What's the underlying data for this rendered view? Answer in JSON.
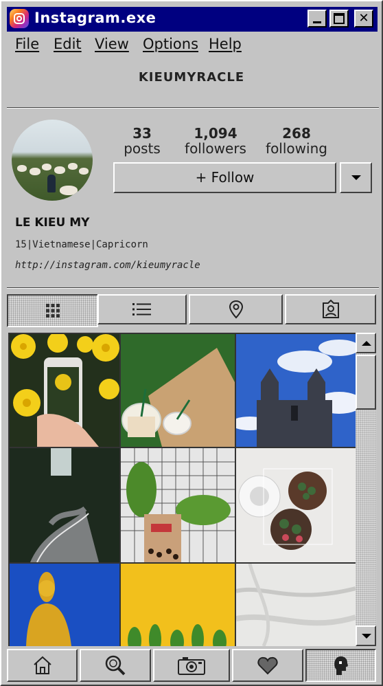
{
  "window": {
    "title": "Instagram.exe",
    "close_glyph": "✕"
  },
  "menu": [
    {
      "label": "File"
    },
    {
      "label": "Edit"
    },
    {
      "label": "View"
    },
    {
      "label": "Options"
    },
    {
      "label": "Help"
    }
  ],
  "profile": {
    "username": "KIEUMYRACLE",
    "display_name": "LE KIEU MY",
    "bio": "15|Vietnamese|Capricorn",
    "link": "http://instagram.com/kieumyracle",
    "stats": {
      "posts": {
        "value": "33",
        "label": "posts"
      },
      "followers": {
        "value": "1,094",
        "label": "followers"
      },
      "following": {
        "value": "268",
        "label": "following"
      }
    },
    "follow_label": "+ Follow"
  },
  "tabs": [
    {
      "icon": "grid-icon",
      "selected": true
    },
    {
      "icon": "list-icon",
      "selected": false
    },
    {
      "icon": "location-pin-icon",
      "selected": false
    },
    {
      "icon": "tagged-user-icon",
      "selected": false
    }
  ],
  "photos": [
    {
      "subject": "phone photographing yellow chrysanthemums"
    },
    {
      "subject": "two iced drinks on wooden table"
    },
    {
      "subject": "cathedral under blue sky"
    },
    {
      "subject": "winding mountain road through forest"
    },
    {
      "subject": "bubble tea cup with green leaves"
    },
    {
      "subject": "succulents in pots on white surface"
    },
    {
      "subject": "golden buddha statue"
    },
    {
      "subject": "plants against yellow wall"
    },
    {
      "subject": "white bed sheets"
    }
  ],
  "bottom_nav": [
    {
      "icon": "home-icon",
      "selected": false
    },
    {
      "icon": "search-icon",
      "selected": false
    },
    {
      "icon": "camera-icon",
      "selected": false
    },
    {
      "icon": "heart-icon",
      "selected": false
    },
    {
      "icon": "profile-icon",
      "selected": true
    }
  ],
  "colors": {
    "titlebar": "#000080",
    "window": "#c4c4c4"
  }
}
